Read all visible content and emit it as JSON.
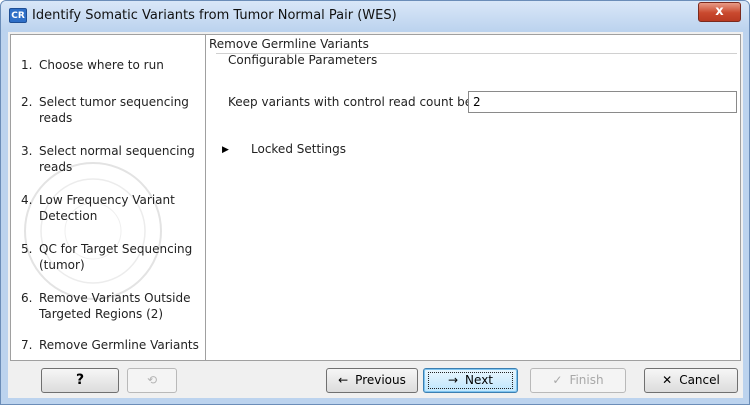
{
  "window": {
    "title": "Identify Somatic Variants from Tumor Normal Pair (WES)",
    "app_icon_text": "CR",
    "close_symbol": "x"
  },
  "steps": [
    {
      "num": "1.",
      "label": "Choose where to run"
    },
    {
      "num": "2.",
      "label": "Select tumor sequencing reads"
    },
    {
      "num": "3.",
      "label": "Select normal sequencing reads"
    },
    {
      "num": "4.",
      "label": "Low Frequency Variant Detection"
    },
    {
      "num": "5.",
      "label": "QC for Target Sequencing (tumor)"
    },
    {
      "num": "6.",
      "label": "Remove Variants Outside Targeted Regions (2)"
    },
    {
      "num": "7.",
      "label": "Remove Germline Variants"
    }
  ],
  "main": {
    "section_title": "Remove Germline Variants",
    "group_title": "Configurable Parameters",
    "param_label": "Keep variants with control read count below",
    "param_value": "2",
    "locked_label": "Locked Settings",
    "locked_arrow": "▶"
  },
  "buttons": {
    "help": "?",
    "history_icon": "⟲",
    "previous": "Previous",
    "previous_icon": "←",
    "next": "Next",
    "next_icon": "→",
    "finish": "Finish",
    "finish_icon": "✓",
    "cancel": "Cancel",
    "cancel_icon": "✕"
  },
  "colors": {
    "titlebar": "#bcd3ee",
    "close_button": "#c9492e",
    "next_highlight": "#bee6fd"
  }
}
